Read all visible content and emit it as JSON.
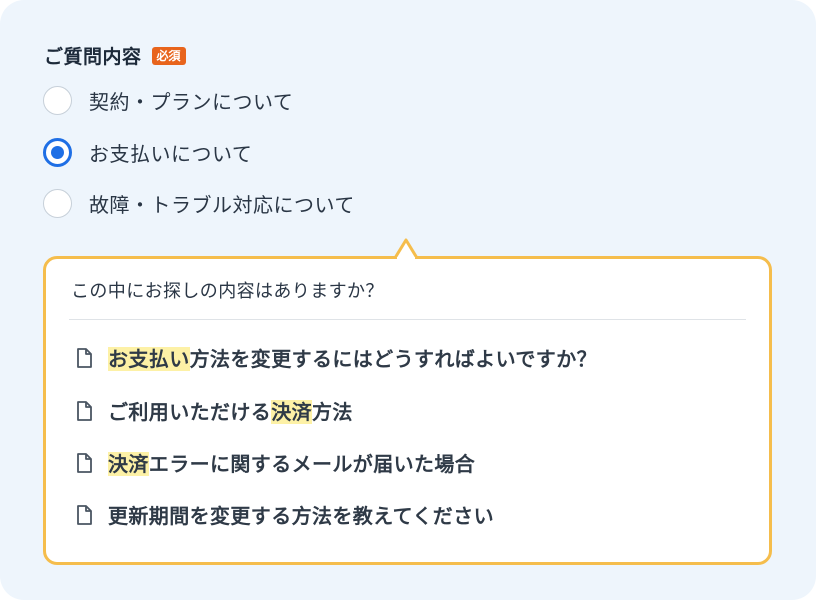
{
  "form": {
    "question_label": "ご質問内容",
    "required_badge": "必須",
    "options": [
      {
        "label": "契約・プランについて",
        "checked": false
      },
      {
        "label": "お支払いについて",
        "checked": true
      },
      {
        "label": "故障・トラブル対応について",
        "checked": false
      }
    ]
  },
  "suggestions": {
    "heading": "この中にお探しの内容はありますか？",
    "items": [
      {
        "parts": [
          "",
          "お支払い",
          "方法を変更するにはどうすればよいですか？"
        ]
      },
      {
        "parts": [
          "ご利用いただける",
          "決済",
          "方法"
        ]
      },
      {
        "parts": [
          "",
          "決済",
          "エラーに関するメールが届いた場合"
        ]
      },
      {
        "parts": [
          "更新期間を変更する方法を教えてください",
          "",
          ""
        ]
      }
    ]
  },
  "colors": {
    "accent": "#1f6fe5",
    "badge": "#e8641c",
    "popover_border": "#f5bd4c",
    "highlight": "#fdf1a6"
  },
  "icons": {
    "suggestion_icon": "document-icon"
  }
}
